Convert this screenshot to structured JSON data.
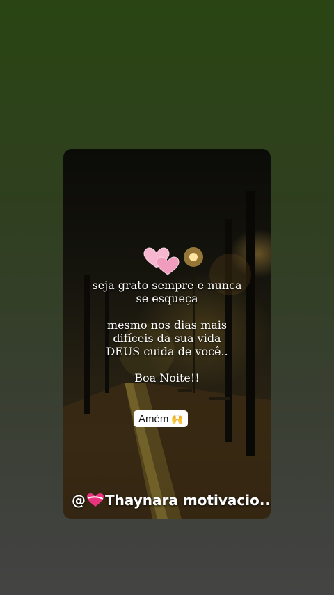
{
  "story": {
    "quote": {
      "line1": "seja grato sempre e nunca",
      "line2": "se esqueça",
      "line3": "mesmo nos dias mais",
      "line4": "difíceis da sua vida",
      "line5": "DEUS cuida de você..",
      "line6": "Boa Noite!!"
    },
    "sticker": {
      "text": "Amém",
      "emoji": "🙌"
    },
    "username": {
      "prefix": "@",
      "name": "Thaynara motivacio..."
    },
    "icons": {
      "hearts": "two-hearts-icon",
      "username_heart": "heart-with-ribbon-icon"
    },
    "colors": {
      "background_top": "#2a4513",
      "background_bottom": "#444444",
      "text": "#ffffff",
      "heart_pink": "#f4a7c6",
      "lamp_glow": "#ffc85a"
    }
  }
}
